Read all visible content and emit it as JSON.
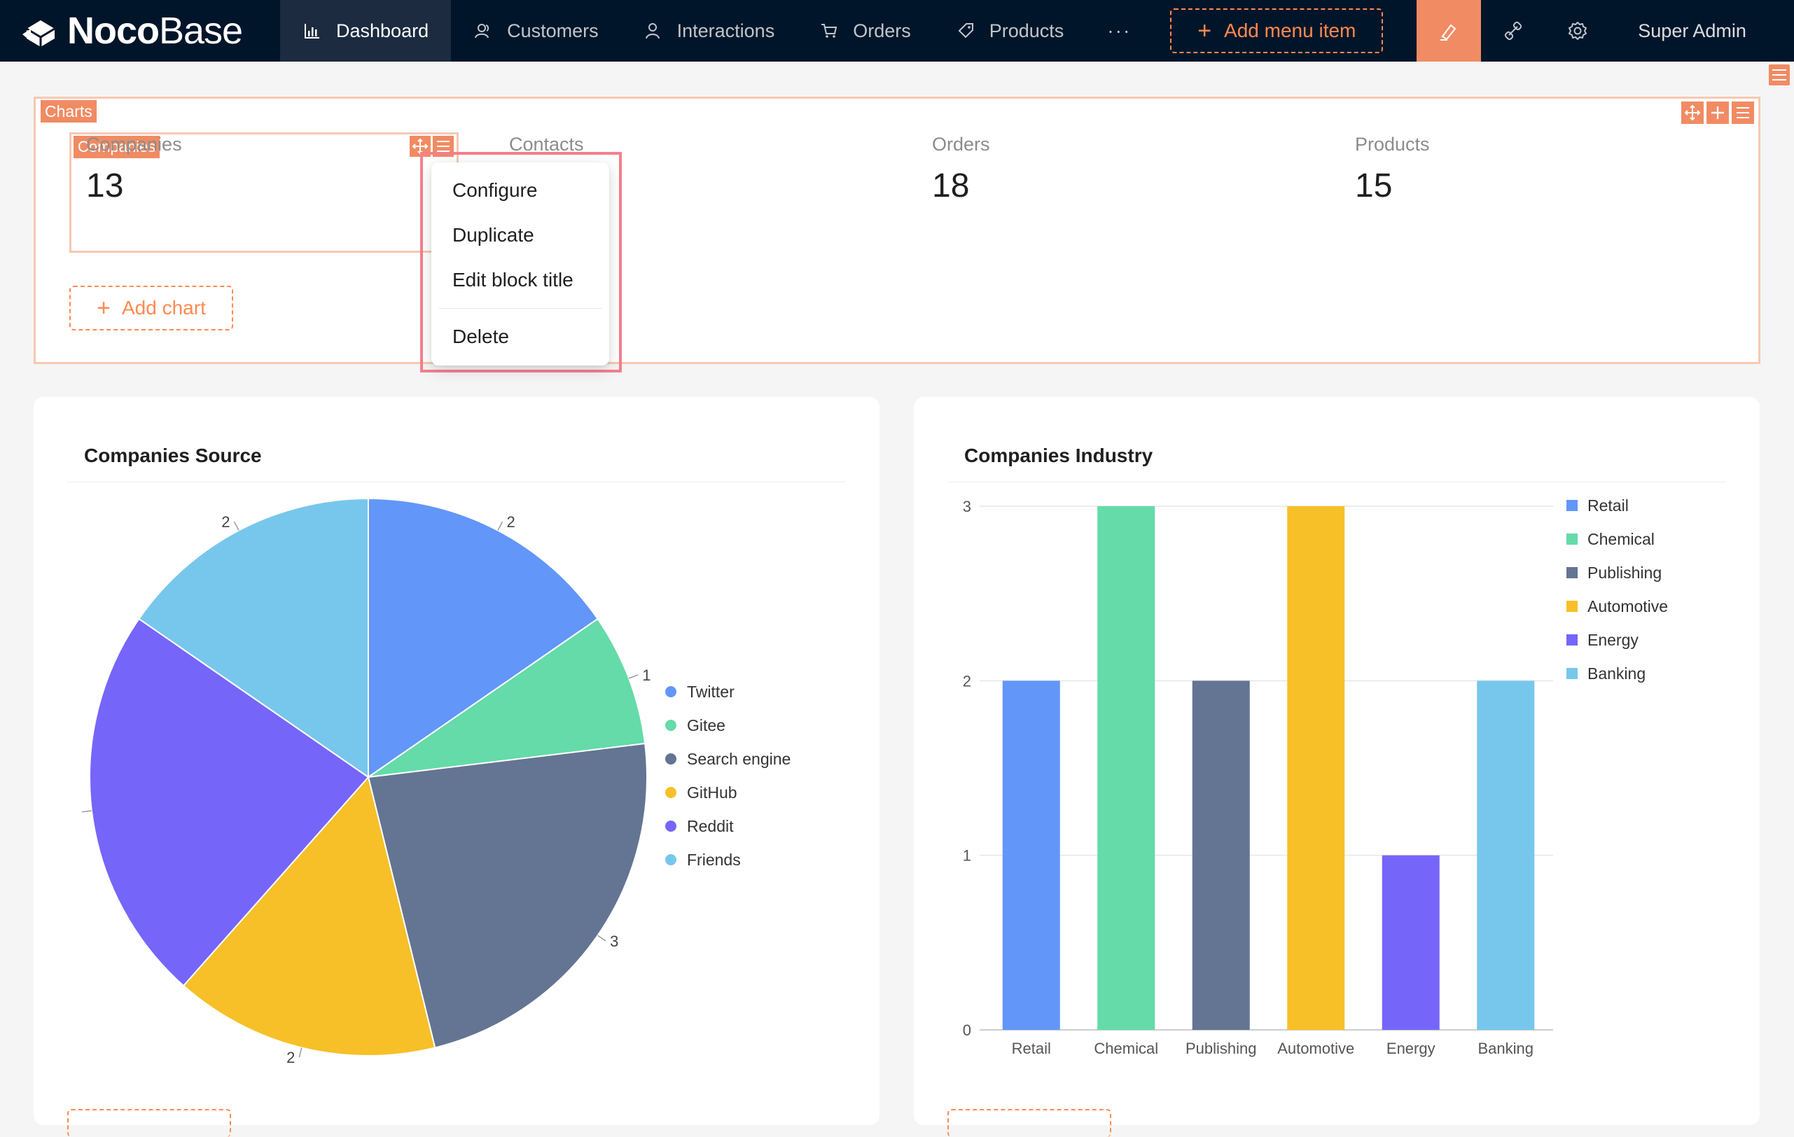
{
  "brand": {
    "bold": "Noco",
    "light": "Base"
  },
  "nav": {
    "items": [
      {
        "label": "Dashboard",
        "icon": "bar-chart-icon",
        "active": true
      },
      {
        "label": "Customers",
        "icon": "contacts-icon"
      },
      {
        "label": "Interactions",
        "icon": "user-icon"
      },
      {
        "label": "Orders",
        "icon": "shopping-cart-icon"
      },
      {
        "label": "Products",
        "icon": "tag-icon"
      }
    ],
    "more": "···",
    "add_menu_label": "Add menu item",
    "user_name": "Super Admin"
  },
  "charts_block": {
    "tag": "Charts",
    "selected_tag": "Companies",
    "stats": [
      {
        "title": "Companies",
        "value": "13"
      },
      {
        "title": "Contacts",
        "value": ""
      },
      {
        "title": "Orders",
        "value": "18"
      },
      {
        "title": "Products",
        "value": "15"
      }
    ],
    "add_chart_label": "Add chart"
  },
  "context_menu": {
    "items": [
      "Configure",
      "Duplicate",
      "Edit block title",
      "Delete"
    ]
  },
  "colors": {
    "accent": "#f18b63",
    "series": [
      "#6296f8",
      "#64dba9",
      "#647493",
      "#f7c028",
      "#7566f9",
      "#77c7ec"
    ]
  },
  "chart_data": [
    {
      "type": "pie",
      "title": "Companies Source",
      "categories": [
        "Twitter",
        "Gitee",
        "Search engine",
        "GitHub",
        "Reddit",
        "Friends"
      ],
      "values": [
        2,
        1,
        3,
        2,
        3,
        2
      ],
      "labels": [
        "2",
        "1",
        "3",
        "2",
        "",
        "2"
      ],
      "legend": "right"
    },
    {
      "type": "bar",
      "title": "Companies Industry",
      "categories": [
        "Retail",
        "Chemical",
        "Publishing",
        "Automotive",
        "Energy",
        "Banking"
      ],
      "values": [
        2,
        3,
        2,
        3,
        1,
        2
      ],
      "yticks": [
        "0",
        "1",
        "2",
        "3"
      ],
      "ylim": [
        0,
        3
      ],
      "legend": "top-right",
      "grid": true
    }
  ]
}
